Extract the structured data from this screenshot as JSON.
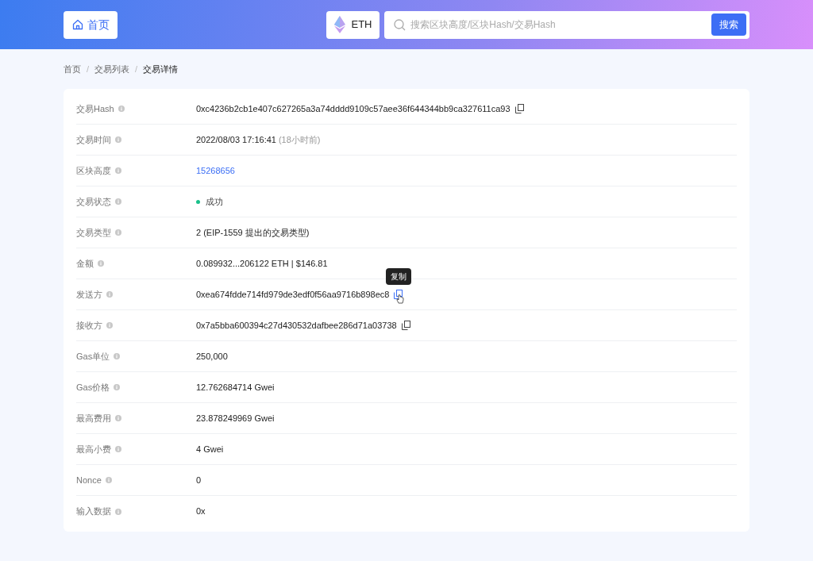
{
  "header": {
    "home_button": "首页",
    "chain_button": "ETH",
    "search": {
      "placeholder": "搜索区块高度/区块Hash/交易Hash",
      "button": "搜索"
    }
  },
  "breadcrumb_separator": "/",
  "breadcrumb": [
    {
      "label": "首页",
      "current": false
    },
    {
      "label": "交易列表",
      "current": false
    },
    {
      "label": "交易详情",
      "current": true
    }
  ],
  "details": [
    {
      "label": "交易Hash",
      "kind": "copyable",
      "value": "0xc4236b2cb1e407c627265a3a74dddd9109c57aee36f644344bb9ca327611ca93",
      "copy_hovered": false
    },
    {
      "label": "交易时间",
      "kind": "time",
      "value": "2022/08/03 17:16:41",
      "note": "(18小时前)"
    },
    {
      "label": "区块高度",
      "kind": "link",
      "value": "15268656"
    },
    {
      "label": "交易状态",
      "kind": "status",
      "value": "成功",
      "color": "#19c08a"
    },
    {
      "label": "交易类型",
      "kind": "text",
      "value": "2 (EIP-1559 提出的交易类型)"
    },
    {
      "label": "金额",
      "kind": "text",
      "value": "0.089932...206122 ETH | $146.81"
    },
    {
      "label": "发送方",
      "kind": "copyable",
      "value": "0xea674fdde714fd979de3edf0f56aa9716b898ec8",
      "copy_hovered": true,
      "tooltip": "复制"
    },
    {
      "label": "接收方",
      "kind": "copyable",
      "value": "0x7a5bba600394c27d430532dafbee286d71a03738",
      "copy_hovered": false
    },
    {
      "label": "Gas单位",
      "kind": "text",
      "value": "250,000"
    },
    {
      "label": "Gas价格",
      "kind": "text",
      "value": "12.762684714 Gwei"
    },
    {
      "label": "最高费用",
      "kind": "text",
      "value": "23.878249969 Gwei"
    },
    {
      "label": "最高小费",
      "kind": "text",
      "value": "4 Gwei"
    },
    {
      "label": "Nonce",
      "kind": "text",
      "value": "0"
    },
    {
      "label": "输入数据",
      "kind": "text",
      "value": "0x"
    }
  ]
}
